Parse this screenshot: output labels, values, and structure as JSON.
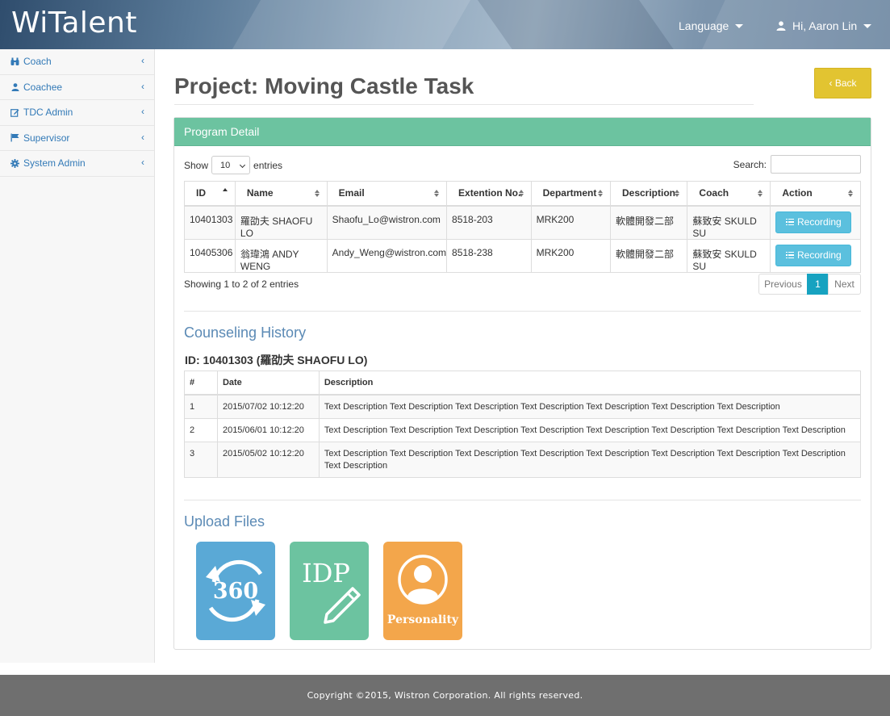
{
  "app": {
    "brand": "WiTalent"
  },
  "header": {
    "language_label": "Language",
    "user_greeting": "Hi, Aaron Lin"
  },
  "sidebar": {
    "items": [
      {
        "label": "Coach",
        "icon": "binoculars-icon"
      },
      {
        "label": "Coachee",
        "icon": "user-icon"
      },
      {
        "label": "TDC Admin",
        "icon": "edit-icon"
      },
      {
        "label": "Supervisor",
        "icon": "flag-icon"
      },
      {
        "label": "System Admin",
        "icon": "gear-icon"
      }
    ]
  },
  "page": {
    "title": "Project: Moving Castle Task",
    "back_label": "‹ Back"
  },
  "program": {
    "panel_title": "Program Detail",
    "show_label": "Show",
    "entries_value": "10",
    "entries_label": "entries",
    "search_label": "Search:",
    "search_value": "",
    "columns": [
      "ID",
      "Name",
      "Email",
      "Extention No.",
      "Department",
      "Description",
      "Coach",
      "Action"
    ],
    "rows": [
      {
        "id": "10401303",
        "name": "羅劭夫 SHAOFU LO",
        "email": "Shaofu_Lo@wistron.com",
        "ext": "8518-203",
        "dept": "MRK200",
        "desc": "軟體開發二部",
        "coach": "蘇致安 SKULD SU",
        "action": "Recording"
      },
      {
        "id": "10405306",
        "name": "翁瑋鴻 ANDY WENG",
        "email": "Andy_Weng@wistron.com",
        "ext": "8518-238",
        "dept": "MRK200",
        "desc": "軟體開發二部",
        "coach": "蘇致安 SKULD SU",
        "action": "Recording"
      }
    ],
    "info": "Showing 1 to 2 of 2 entries",
    "pager": {
      "previous": "Previous",
      "current": "1",
      "next": "Next"
    }
  },
  "history": {
    "title": "Counseling History",
    "subtitle": "ID: 10401303 (羅劭夫 SHAOFU LO)",
    "columns": [
      "#",
      "Date",
      "Description"
    ],
    "rows": [
      {
        "n": "1",
        "date": "2015/07/02 10:12:20",
        "desc": "Text Description Text Description Text Description Text Description Text Description Text Description Text Description"
      },
      {
        "n": "2",
        "date": "2015/06/01 10:12:20",
        "desc": "Text Description Text Description Text Description Text Description Text Description Text Description Text Description Text Description"
      },
      {
        "n": "3",
        "date": "2015/05/02 10:12:20",
        "desc": "Text Description Text Description Text Description Text Description Text Description Text Description Text Description Text Description Text Description"
      }
    ]
  },
  "upload": {
    "title": "Upload Files",
    "tiles": [
      {
        "label": "360",
        "color": "#5aa9d6"
      },
      {
        "label": "IDP",
        "color": "#6cc3a0"
      },
      {
        "label": "Personality",
        "color": "#f3a64b"
      }
    ]
  },
  "footer": {
    "text": "Copyright ©2015, Wistron Corporation. All rights reserved."
  }
}
